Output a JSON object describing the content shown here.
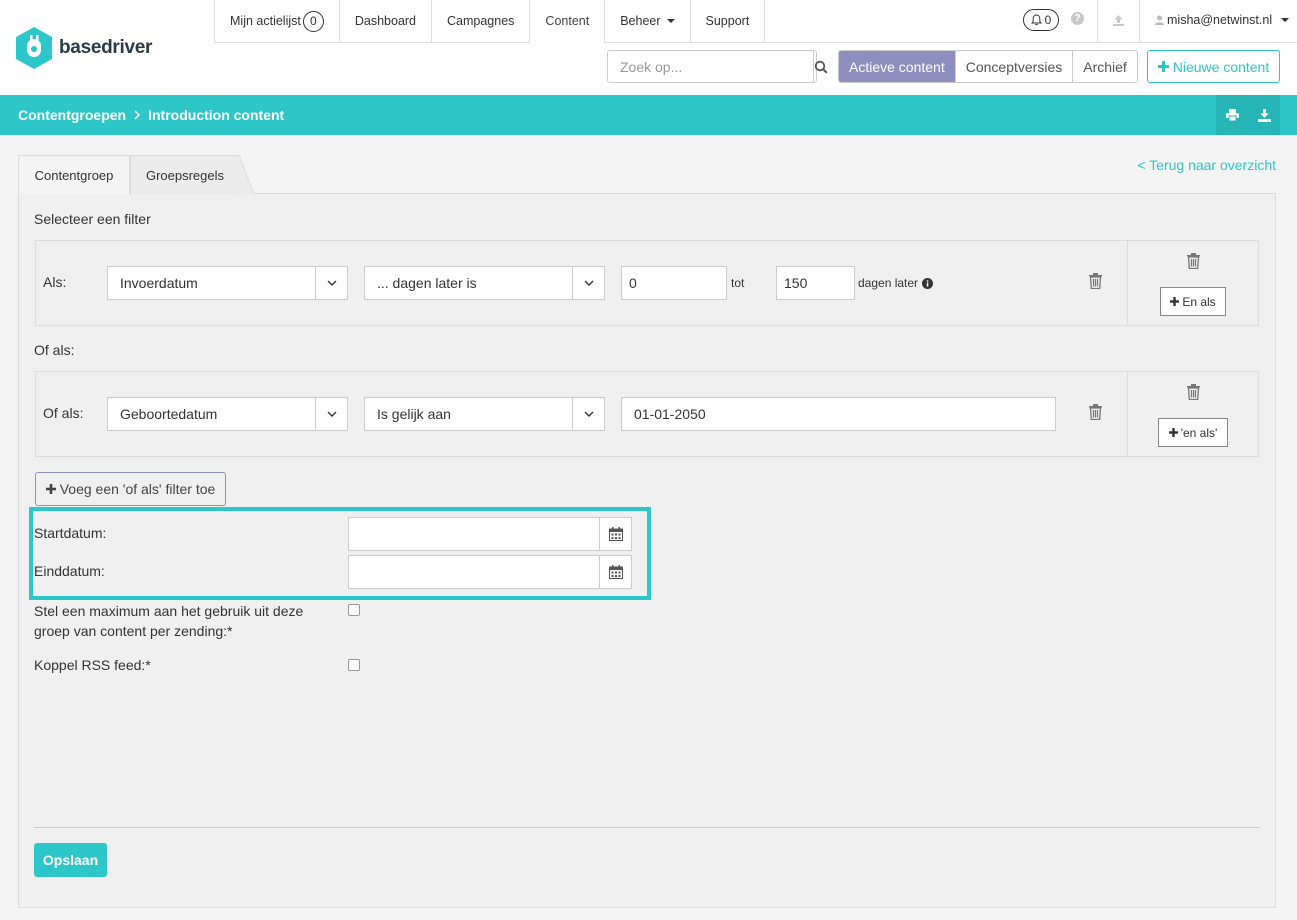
{
  "brand": {
    "name": "basedriver",
    "accent": "#2ec7c9",
    "purple": "#8e8fbf"
  },
  "topnav": {
    "items": [
      {
        "label": "Mijn actielijst",
        "badge": "0"
      },
      {
        "label": "Dashboard"
      },
      {
        "label": "Campagnes"
      },
      {
        "label": "Content",
        "active": true
      },
      {
        "label": "Beheer",
        "dropdown": true
      },
      {
        "label": "Support"
      }
    ],
    "notifications": "0",
    "user": "misha@netwinst.nl"
  },
  "search": {
    "placeholder": "Zoek op..."
  },
  "segments": [
    "Actieve content",
    "Conceptversies",
    "Archief"
  ],
  "new_content": "Nieuwe content",
  "breadcrumb": [
    "Contentgroepen",
    "Introduction content"
  ],
  "tabs": [
    "Contentgroep",
    "Groepsregels"
  ],
  "back_link": "< Terug naar overzicht",
  "filter": {
    "heading": "Selecteer een filter",
    "rule1": {
      "label": "Als:",
      "field": "Invoerdatum",
      "operator": "... dagen later is",
      "from": "0",
      "between": "tot",
      "to": "150",
      "suffix": "dagen later",
      "and_button": "En als"
    },
    "or_heading": "Of als:",
    "rule2": {
      "label": "Of als:",
      "field": "Geboortedatum",
      "operator": "Is gelijk aan",
      "value": "01-01-2050",
      "and_button": "'en als'"
    },
    "add_or_button": "Voeg een 'of als' filter toe"
  },
  "dates": {
    "start_label": "Startdatum:",
    "end_label": "Einddatum:"
  },
  "options": {
    "max_usage_label_1": "Stel een maximum aan het gebruik uit deze",
    "max_usage_label_2": "groep van content per zending:*",
    "rss_label": "Koppel RSS feed:*"
  },
  "save": "Opslaan"
}
